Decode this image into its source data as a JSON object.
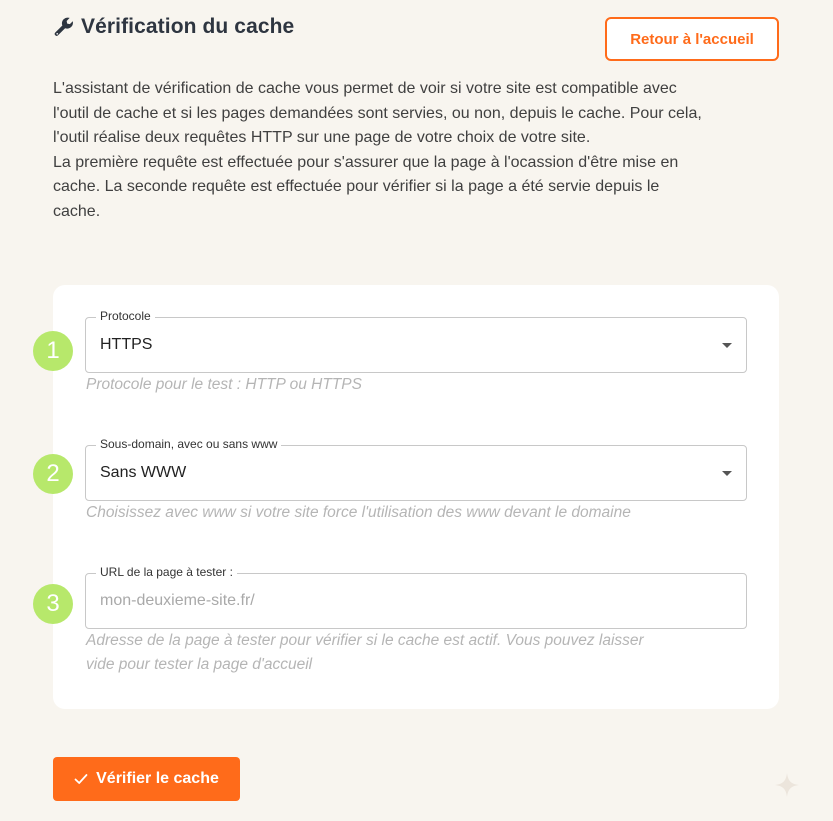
{
  "header": {
    "title": "Vérification du cache",
    "title_icon": "wrench-icon",
    "back_button_label": "Retour à l'accueil"
  },
  "intro": {
    "lines": [
      "L'assistant de vérification de cache vous permet de voir si votre site est compatible avec",
      "l'outil de cache et si les pages demandées sont servies, ou non, depuis le cache. Pour cela,",
      "l'outil réalise deux requêtes HTTP sur une page de votre choix de votre site.",
      "La première requête est effectuée pour s'assurer que la page à l'ocassion d'être mise en",
      "cache. La seconde requête est effectuée pour vérifier si la page a été servie depuis le",
      "cache."
    ]
  },
  "form": {
    "steps": [
      {
        "number": "1",
        "label": "Protocole",
        "value": "HTTPS",
        "helper": "Protocole pour le test : HTTP ou HTTPS"
      },
      {
        "number": "2",
        "label": "Sous-domain, avec ou sans www",
        "value": "Sans WWW",
        "helper": "Choisissez avec www si votre site force l'utilisation des www devant le domaine"
      },
      {
        "number": "3",
        "label": "URL de la page à tester :",
        "placeholder": "mon-deuxieme-site.fr/",
        "value": "",
        "helper_lines": [
          "Adresse de la page à tester pour vérifier si le cache est actif. Vous pouvez laisser",
          "vide pour tester la page d'accueil"
        ]
      }
    ]
  },
  "actions": {
    "verify_label": "Vérifier le cache",
    "verify_icon": "check-icon"
  },
  "colors": {
    "accent": "#ff6b1a",
    "step_badge": "#b7e86b",
    "background": "#f8f5ef"
  }
}
